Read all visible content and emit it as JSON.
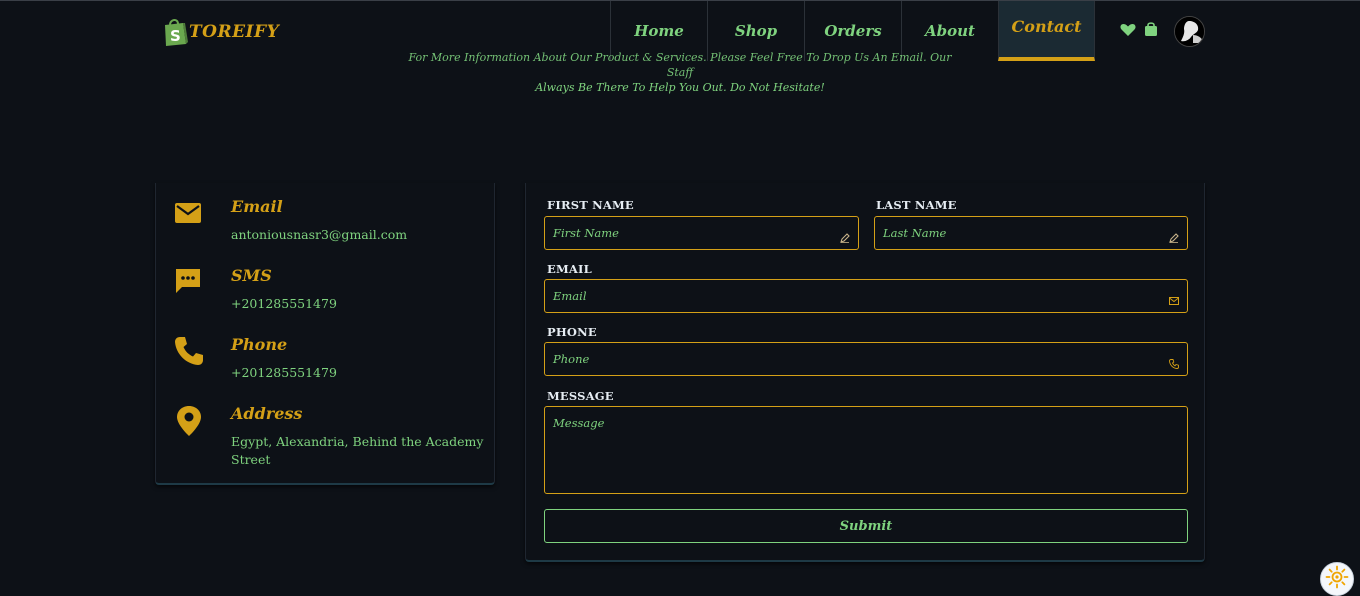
{
  "brand": {
    "name": "TOREIFY",
    "logo_letter": "S",
    "icon": "shopping-bag-icon"
  },
  "nav": {
    "links": [
      {
        "label": "Home",
        "active": false
      },
      {
        "label": "Shop",
        "active": false
      },
      {
        "label": "Orders",
        "active": false
      },
      {
        "label": "About",
        "active": false
      },
      {
        "label": "Contact",
        "active": true
      }
    ],
    "icons": [
      "heart-icon",
      "cart-bag-icon",
      "avatar"
    ]
  },
  "intro": {
    "line1": "For More Information About Our Product & Services. Please Feel Free To Drop Us An Email. Our Staff",
    "line2": "Always Be There To Help You Out. Do Not Hesitate!"
  },
  "contact_info": [
    {
      "title": "Email",
      "value": "antoniousnasr3@gmail.com",
      "icon": "mail-icon"
    },
    {
      "title": "SMS",
      "value": "+201285551479",
      "icon": "chat-bubble-icon"
    },
    {
      "title": "Phone",
      "value": "+201285551479",
      "icon": "phone-icon"
    },
    {
      "title": "Address",
      "value": "Egypt, Alexandria, Behind the Academy Street",
      "icon": "location-pin-icon"
    }
  ],
  "form": {
    "first_name": {
      "label": "FIRST NAME",
      "placeholder": "First Name",
      "icon": "pencil-icon"
    },
    "last_name": {
      "label": "LAST NAME",
      "placeholder": "Last Name",
      "icon": "pencil-icon"
    },
    "email": {
      "label": "EMAIL",
      "placeholder": "Email",
      "icon": "envelope-icon"
    },
    "phone": {
      "label": "PHONE",
      "placeholder": "Phone",
      "icon": "phone-icon"
    },
    "message": {
      "label": "MESSAGE",
      "placeholder": "Message"
    },
    "submit_label": "Submit"
  },
  "colors": {
    "background": "#0d1117",
    "accent": "#d4a017",
    "text_green": "#7fd37f",
    "label_white": "#e6edf3",
    "active_nav_bg": "#1b2a33"
  },
  "theme_toggle": {
    "icon": "sun-icon"
  }
}
